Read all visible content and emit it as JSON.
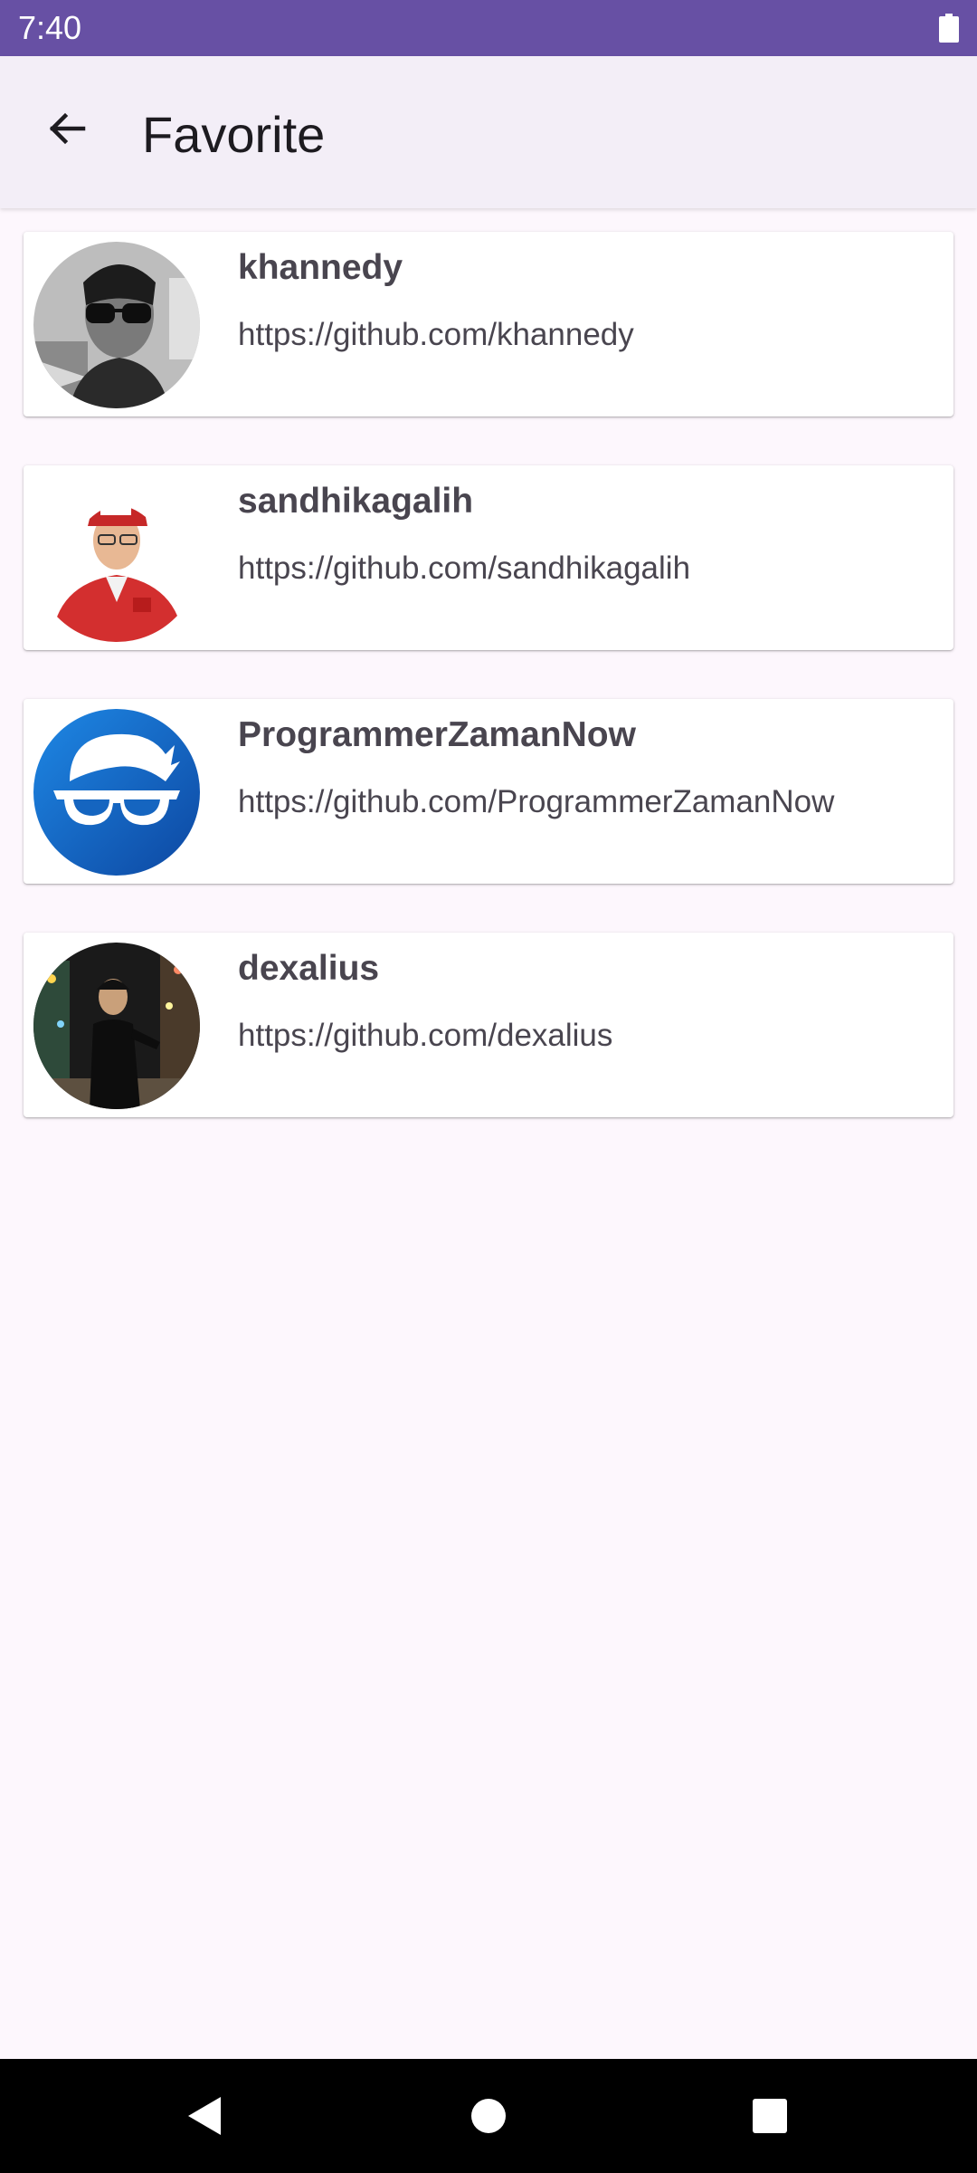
{
  "status_bar": {
    "time": "7:40",
    "icons": [
      "battery-icon"
    ]
  },
  "app_bar": {
    "title": "Favorite",
    "back_icon": "arrow-left-icon"
  },
  "favorites": [
    {
      "username": "khannedy",
      "url": "https://github.com/khannedy"
    },
    {
      "username": "sandhikagalih",
      "url": "https://github.com/sandhikagalih"
    },
    {
      "username": "ProgrammerZamanNow",
      "url": "https://github.com/ProgrammerZamanNow"
    },
    {
      "username": "dexalius",
      "url": "https://github.com/dexalius"
    }
  ],
  "nav_bar": {
    "icons": [
      "back-triangle-icon",
      "home-circle-icon",
      "recents-square-icon"
    ]
  },
  "colors": {
    "status_bar": "#6750a4",
    "app_bar": "#f3eef7",
    "background": "#fdf7fd",
    "text": "#49454f",
    "title": "#1d1b20"
  }
}
